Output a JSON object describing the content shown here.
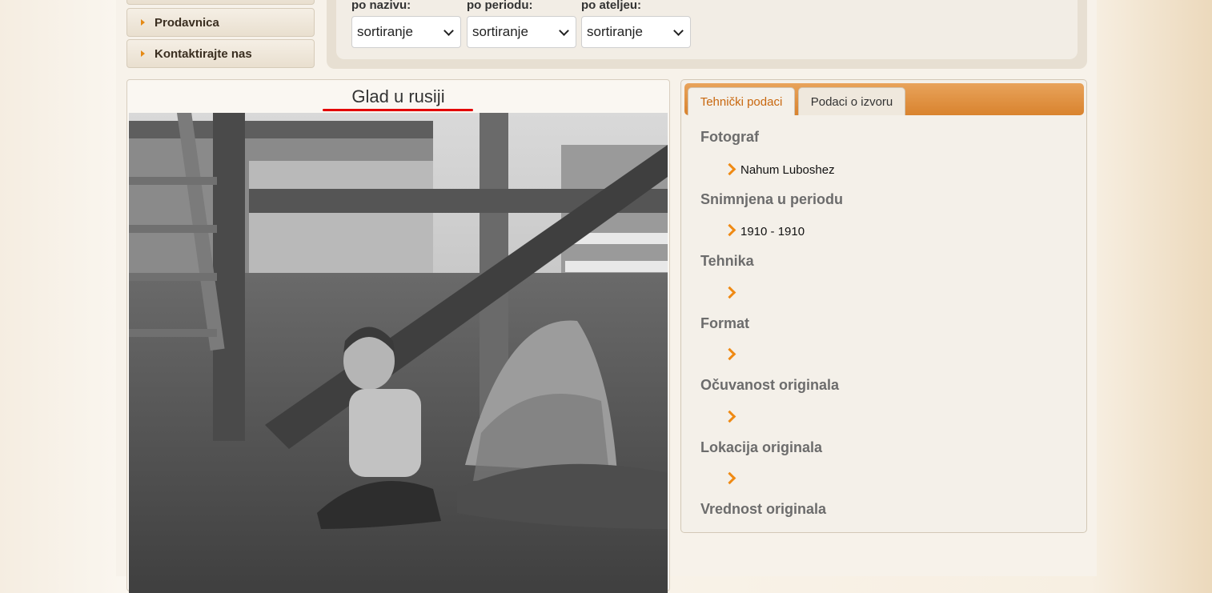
{
  "nav": {
    "items": [
      {
        "label": ""
      },
      {
        "label": "Prodavnica"
      },
      {
        "label": "Kontaktirajte nas"
      }
    ]
  },
  "filters": [
    {
      "label": "po nazivu:",
      "selected": "sortiranje"
    },
    {
      "label": "po periodu:",
      "selected": "sortiranje"
    },
    {
      "label": "po ateljeu:",
      "selected": "sortiranje"
    }
  ],
  "photo": {
    "title": "Glad u rusiji"
  },
  "tabs": [
    {
      "label": "Tehnički podaci",
      "active": true
    },
    {
      "label": "Podaci o izvoru",
      "active": false
    }
  ],
  "details": [
    {
      "title": "Fotograf",
      "value": "Nahum Luboshez"
    },
    {
      "title": "Snimnjena u periodu",
      "value": "1910 - 1910"
    },
    {
      "title": "Tehnika",
      "value": ""
    },
    {
      "title": "Format",
      "value": ""
    },
    {
      "title": "Očuvanost originala",
      "value": ""
    },
    {
      "title": "Lokacija originala",
      "value": ""
    },
    {
      "title": "Vrednost originala",
      "value": ""
    }
  ],
  "colors": {
    "accent": "#ef8a14",
    "annotation": "#e30000"
  }
}
